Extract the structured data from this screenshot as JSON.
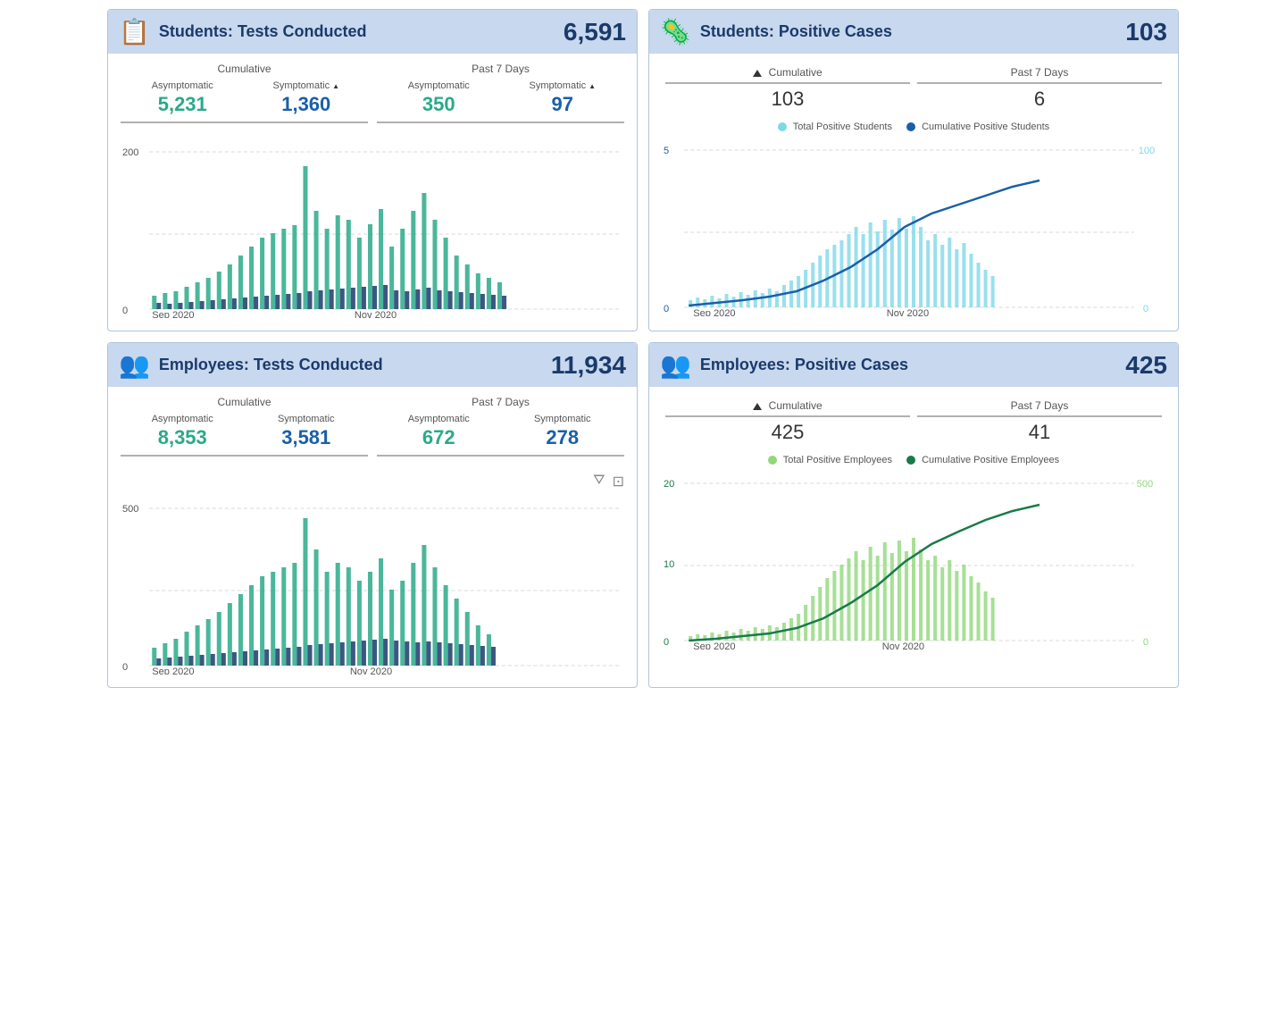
{
  "students_tests": {
    "title": "Students: Tests Conducted",
    "total": "6,591",
    "cumulative_label": "Cumulative",
    "past7_label": "Past 7 Days",
    "asymptomatic_label": "Asymptomatic",
    "symptomatic_label": "Symptomatic",
    "cum_asymptomatic": "5,231",
    "cum_symptomatic": "1,360",
    "p7_asymptomatic": "350",
    "p7_symptomatic": "97",
    "x_start": "Sep 2020",
    "x_mid": "Nov 2020",
    "y_top": "200",
    "y_zero": "0"
  },
  "students_cases": {
    "title": "Students: Positive Cases",
    "total": "103",
    "cumulative_label": "Cumulative",
    "past7_label": "Past 7 Days",
    "cum_value": "103",
    "p7_value": "6",
    "legend_light": "Total Positive Students",
    "legend_dark": "Cumulative Positive Students",
    "y_left_top": "5",
    "y_left_zero": "0",
    "y_right_top": "100",
    "y_right_zero": "0",
    "x_start": "Sep 2020",
    "x_mid": "Nov 2020"
  },
  "employees_tests": {
    "title": "Employees: Tests Conducted",
    "total": "11,934",
    "cumulative_label": "Cumulative",
    "past7_label": "Past 7 Days",
    "asymptomatic_label": "Asymptomatic",
    "symptomatic_label": "Symptomatic",
    "cum_asymptomatic": "8,353",
    "cum_symptomatic": "3,581",
    "p7_asymptomatic": "672",
    "p7_symptomatic": "278",
    "x_start": "Sep 2020",
    "x_mid": "Nov 2020",
    "y_top": "500",
    "y_zero": "0"
  },
  "employees_cases": {
    "title": "Employees: Positive Cases",
    "total": "425",
    "cumulative_label": "Cumulative",
    "past7_label": "Past 7 Days",
    "cum_value": "425",
    "p7_value": "41",
    "legend_light": "Total Positive Employees",
    "legend_dark": "Cumulative Positive Employees",
    "y_left_top": "20",
    "y_left_zero": "0",
    "y_right_top": "500",
    "y_right_zero": "0",
    "x_start": "Sep 2020",
    "x_mid": "Nov 2020"
  }
}
